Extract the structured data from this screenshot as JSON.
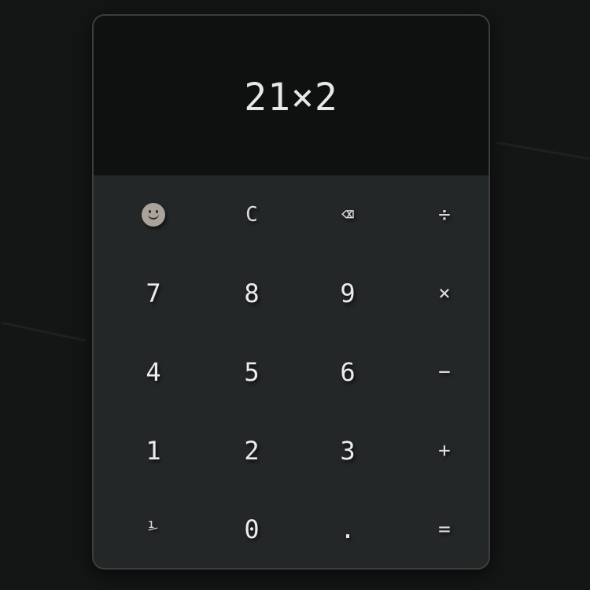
{
  "display": {
    "expression": "21×2"
  },
  "keys": {
    "row1": [
      "",
      "C",
      "⌫",
      "÷"
    ],
    "row2": [
      "7",
      "8",
      "9",
      "×"
    ],
    "row3": [
      "4",
      "5",
      "6",
      "−"
    ],
    "row4": [
      "1",
      "2",
      "3",
      "+"
    ],
    "row5": [
      "⅟",
      "0",
      ".",
      "="
    ]
  },
  "icons": {
    "emoji": "smiley-face-icon",
    "backspace": "backspace-icon"
  },
  "colors": {
    "page_background": "#141515",
    "display_background": "#0f1111",
    "keypad_background": "#242728",
    "text": "#ececec",
    "smiley": "#a9a39b"
  }
}
